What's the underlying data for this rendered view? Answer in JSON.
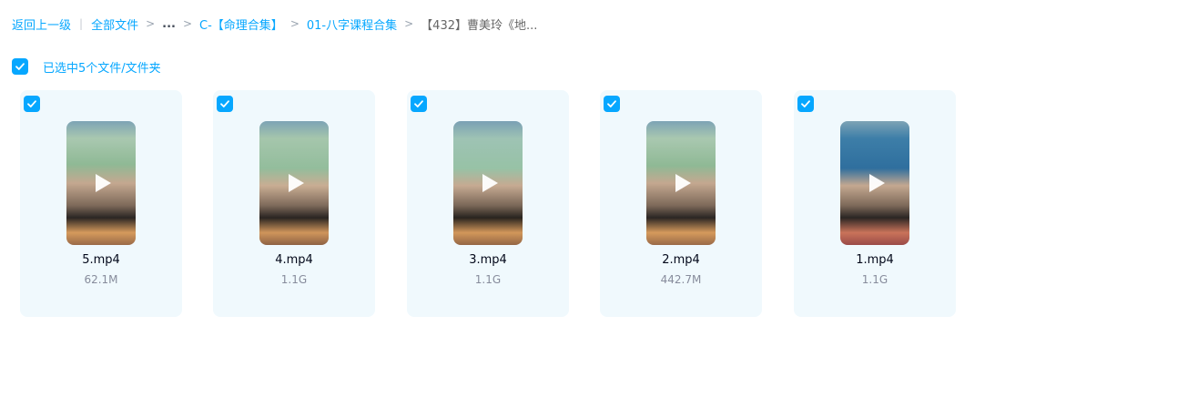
{
  "breadcrumb": {
    "back": "返回上一级",
    "all_files": "全部文件",
    "ellipsis": "...",
    "folder1": "C-【命理合集】",
    "folder2": "01-八字课程合集",
    "current": "【432】曹美玲《地...",
    "separator": ">",
    "divider": "|"
  },
  "selection": {
    "label": "已选中5个文件/文件夹",
    "checked": true
  },
  "accent_color": "#06a7ff",
  "files": [
    {
      "name": "5.mp4",
      "size": "62.1M",
      "checked": true,
      "icon": "video-thumbnail"
    },
    {
      "name": "4.mp4",
      "size": "1.1G",
      "checked": true,
      "icon": "video-thumbnail"
    },
    {
      "name": "3.mp4",
      "size": "1.1G",
      "checked": true,
      "icon": "video-thumbnail"
    },
    {
      "name": "2.mp4",
      "size": "442.7M",
      "checked": true,
      "icon": "video-thumbnail"
    },
    {
      "name": "1.mp4",
      "size": "1.1G",
      "checked": true,
      "icon": "video-thumbnail"
    }
  ]
}
